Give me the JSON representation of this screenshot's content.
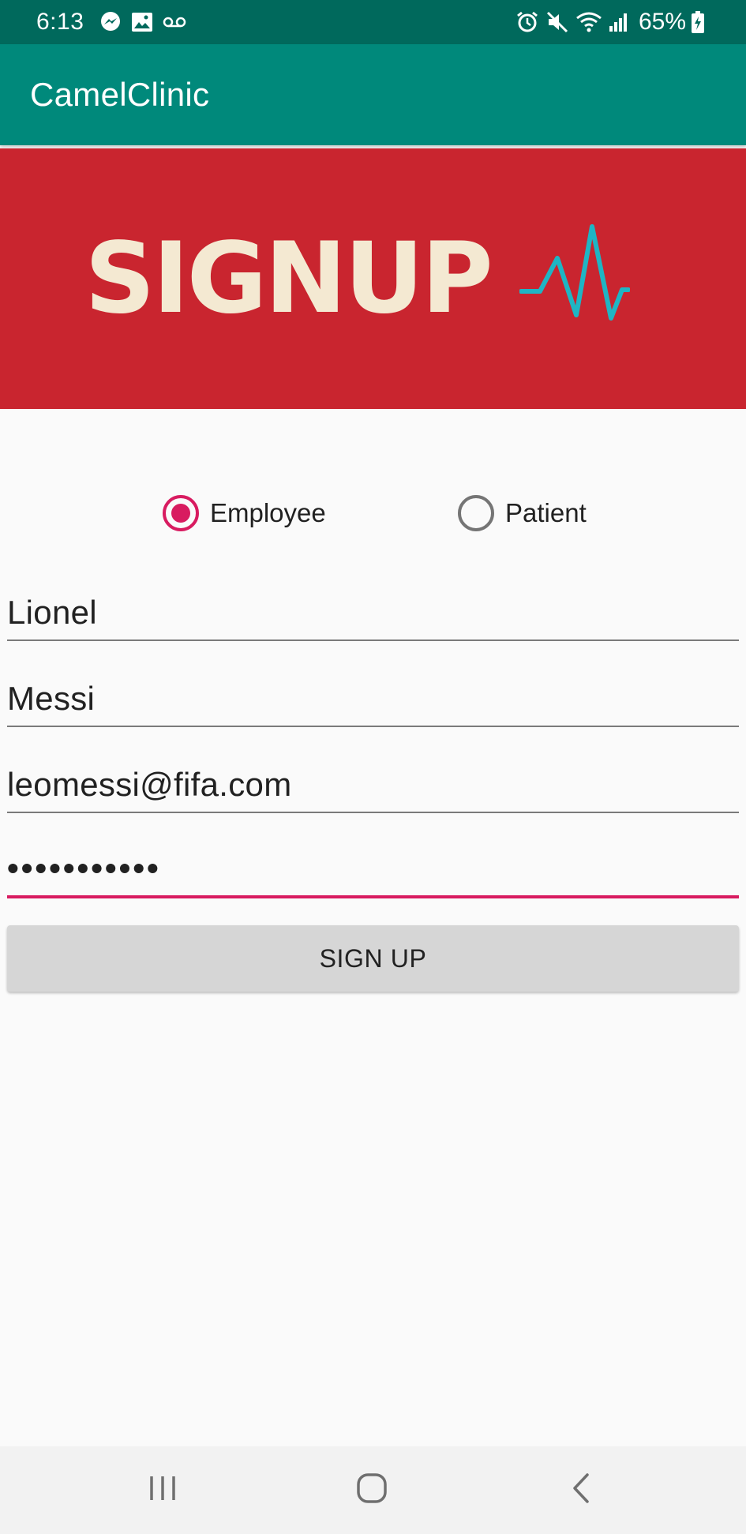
{
  "status_bar": {
    "time": "6:13",
    "battery": "65%",
    "left_icons": [
      "messenger-icon",
      "gallery-icon",
      "voicemail-icon"
    ],
    "right_icons": [
      "alarm-icon",
      "mute-icon",
      "wifi-icon",
      "signal-icon",
      "battery-icon"
    ]
  },
  "app_bar": {
    "title": "CamelClinic"
  },
  "banner": {
    "text": "SIGNUP",
    "icon": "heartbeat-icon"
  },
  "form": {
    "role_options": [
      {
        "label": "Employee",
        "checked": true
      },
      {
        "label": "Patient",
        "checked": false
      }
    ],
    "first_name": "Lionel",
    "last_name": "Messi",
    "email": "leomessi@fifa.com",
    "password_masked": "•••••••••••",
    "submit_label": "SIGN UP"
  },
  "nav_bar": {
    "icons": [
      "recent-apps-icon",
      "home-icon",
      "back-icon"
    ]
  },
  "colors": {
    "status_bar": "#00695c",
    "app_bar": "#00897b",
    "banner_background": "#c9252f",
    "banner_text": "#f4e9d2",
    "heartbeat": "#1fb5c4",
    "accent": "#d81b60",
    "button_background": "#d6d6d6"
  }
}
